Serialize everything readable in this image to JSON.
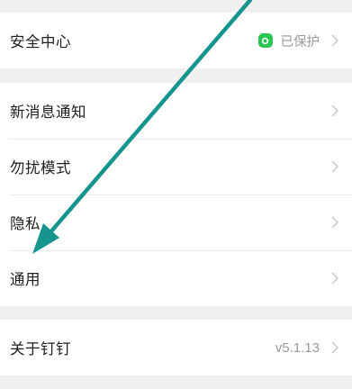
{
  "settings": {
    "security": {
      "label": "安全中心",
      "status": "已保护",
      "icon": "shield-icon",
      "status_color": "#29c653"
    },
    "notifications": {
      "label": "新消息通知"
    },
    "dnd": {
      "label": "勿扰模式"
    },
    "privacy": {
      "label": "隐私"
    },
    "general": {
      "label": "通用"
    },
    "about": {
      "label": "关于钉钉",
      "version": "v5.1.13"
    }
  },
  "overlay": {
    "annotation_arrow_color": "#16958e"
  }
}
